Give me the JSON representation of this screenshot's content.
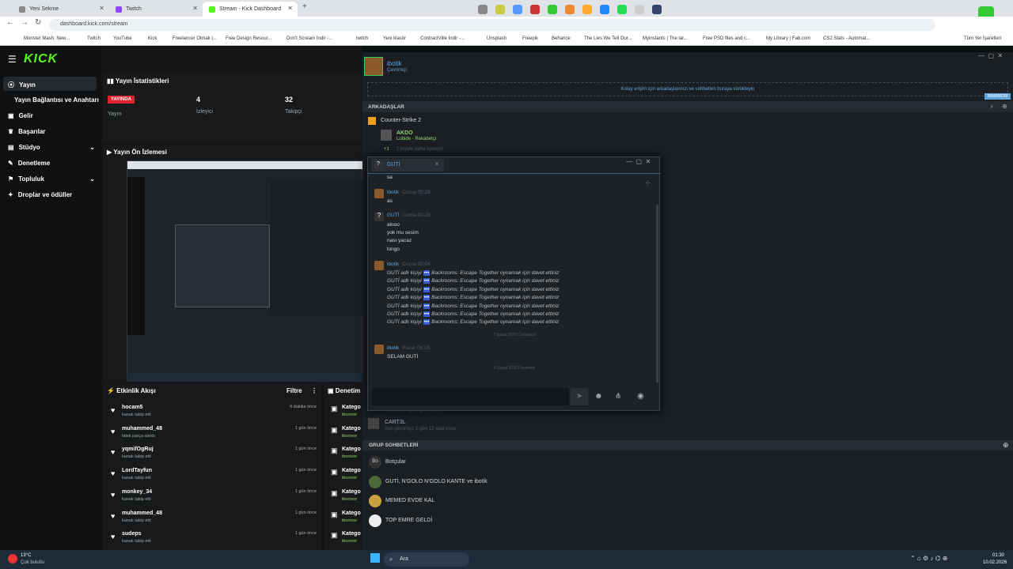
{
  "browser": {
    "tabs": [
      "Yeni Sekme",
      "Twitch",
      "Stream - Kick Dashboard"
    ],
    "url": "dashboard.kick.com/stream",
    "bookmarks": [
      "Monster Mash: New...",
      "Twitch",
      "YouTube",
      "Kick",
      "Freelancer Olmak |...",
      "Free Design Resour...",
      "Don't Scream İndir -...",
      "twitch",
      "Yeni klasör",
      "ContractVille İndir -...",
      "Unsplash",
      "Freepik",
      "Behance",
      "The Lies We Tell Our...",
      "Myinstants | The lar...",
      "Free PSD files and c...",
      "My Library | Fab.com",
      "CS2 Stats - Automat...",
      "Tüm Yer İşaretleri"
    ]
  },
  "kick": {
    "logo": "KICK",
    "sidebar": [
      "Yayın",
      "Yayın Bağlantısı ve Anahtarı",
      "Gelir",
      "Başarılar",
      "Stüdyo",
      "Denetleme",
      "Topluluk",
      "Droplar ve ödüller"
    ],
    "stats_title": "Yayın İstatistikleri",
    "live_badge": "YAYINDA",
    "stream_label": "Yayın",
    "viewers": "4",
    "viewers_label": "İzleyici",
    "followers": "32",
    "followers_label": "Takipçi",
    "preview_title": "Yayın Ön İzlemesi",
    "events_title": "Etkinlik Akışı",
    "filter": "Filtre",
    "moderation_title": "Denetim İ",
    "events": [
      {
        "name": "hocam5",
        "sub": "kanalı takip etti",
        "time": "4 dakika önce"
      },
      {
        "name": "muhammed_48",
        "sub": "latek parça alındı",
        "time": "1 gün önce"
      },
      {
        "name": "yqmifOgRuj",
        "sub": "kanalı takip etti",
        "time": "1 gün önce"
      },
      {
        "name": "LordTayfun",
        "sub": "kanalı takip etti",
        "time": "1 gün önce"
      },
      {
        "name": "monkey_34",
        "sub": "kanalı takip etti",
        "time": "1 gün önce"
      },
      {
        "name": "muhammed_48",
        "sub": "kanalı takip etti",
        "time": "1 gün önce"
      },
      {
        "name": "sudeps",
        "sub": "kanalı takip etti",
        "time": "1 gün önce"
      }
    ],
    "mod_items": [
      "Katego",
      "Katego",
      "Katego",
      "Katego",
      "Katego",
      "Katego",
      "Katego"
    ],
    "mod_sub": "ibonivor"
  },
  "steam": {
    "user": "ibotik",
    "status": "Çevrimiçi",
    "drag_hint": "Kolay erişim için arkadaşlarınızı ve sohbetleri buraya sürükleyin",
    "tamamori": "TAMAMORI",
    "friends_header": "ARKADAŞLAR",
    "game": "Counter-Strike 2",
    "friend_name": "AKDO",
    "friend_status": "Lobide - Rekabetçi",
    "more": "+1",
    "more_text": "1 kişiyle daha oynuyor",
    "offline_friend": "CART3L",
    "offline_status": "Son çevrimiçi: 1 gün 12 saat önce",
    "offline_prev": "Son çevrimiçi: 1 gün önce",
    "group_header": "GRUP SOHBETLERİ",
    "groups": [
      "Botçular",
      "GUTİ, N'GOLO N'GOLO KANTE ve ibotik",
      "MEMED EVDE KAL",
      "TOP EMRE GELDİ"
    ],
    "group_initials": "Bo"
  },
  "chat": {
    "tab": "GUTİ",
    "first": "sa",
    "m1_name": "ibotik",
    "m1_time": "Cuma 00:28",
    "m1_text": "as",
    "m2_name": "GUTİ",
    "m2_time": "Cuma 00:28",
    "m2_lines": [
      "alooo",
      "yok mu sesim",
      "nası yacaz",
      "longo"
    ],
    "m3_name": "ibotik",
    "m3_time": "Cuma 00:04",
    "invite_prefix": "GUTİ adlı kişiyi",
    "invite_text": "Backrooms: Escape Together oynamak için davet ettiniz",
    "date1": "7 Şubat 2026 Cumartesi",
    "m4_name": "ibotik",
    "m4_time": "Pazar 06:05",
    "m4_text": "SELAM GUTİ",
    "date2": "8 Şubat 2026 Pazartesi"
  },
  "taskbar": {
    "temp": "13°C",
    "weather": "Çok bulutlu",
    "search": "Ara",
    "time": "01:30",
    "date": "10.02.2026"
  }
}
